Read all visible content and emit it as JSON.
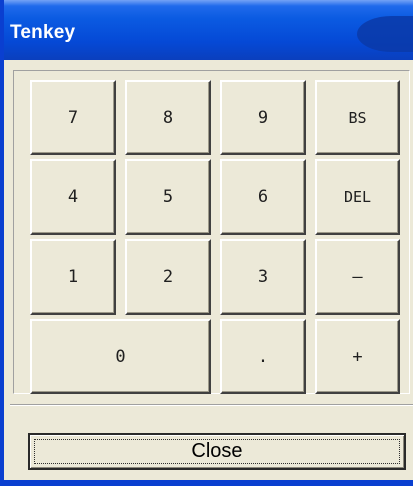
{
  "window": {
    "title": "Tenkey"
  },
  "keypad": {
    "keys": {
      "k7": "7",
      "k8": "8",
      "k9": "9",
      "bs": "BS",
      "k4": "4",
      "k5": "5",
      "k6": "6",
      "del": "DEL",
      "k1": "1",
      "k2": "2",
      "k3": "3",
      "minus": "–",
      "k0": "0",
      "dot": ".",
      "plus": "+"
    }
  },
  "footer": {
    "close_label": "Close"
  },
  "colors": {
    "titlebar": "#0549d6",
    "window_face": "#ece9d8",
    "title_text": "#ffffff"
  }
}
